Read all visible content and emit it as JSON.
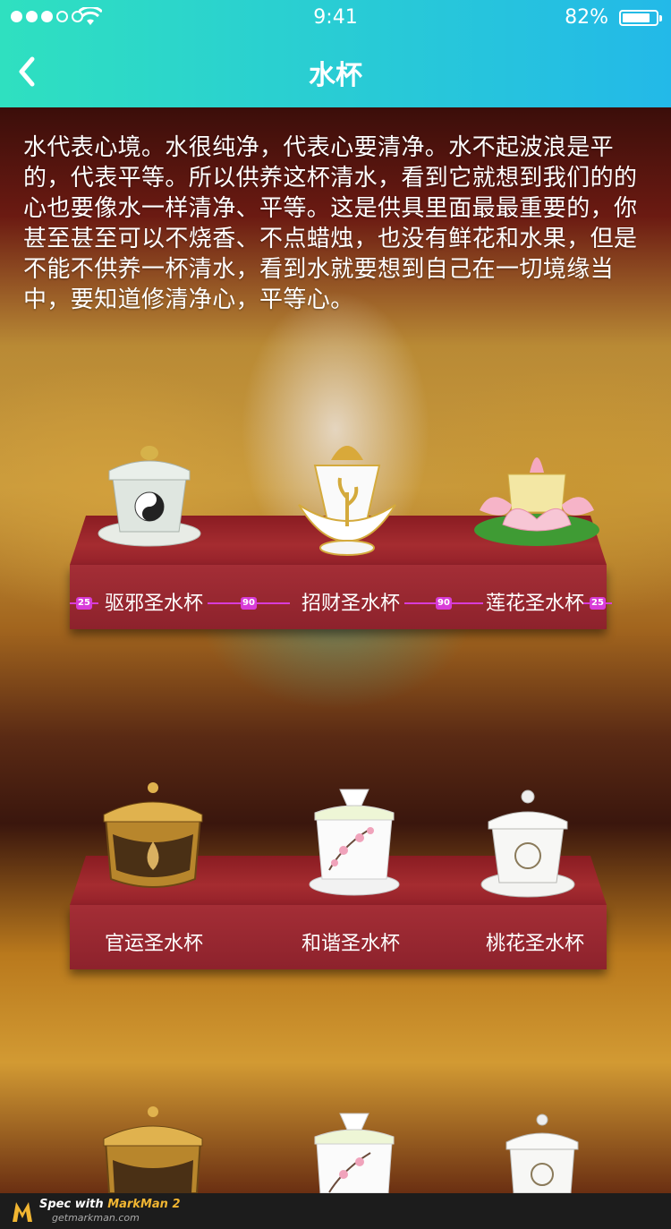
{
  "status_bar": {
    "time": "9:41",
    "battery": "82%",
    "battery_level": 0.82,
    "signal_bars": 3,
    "signal_total": 5
  },
  "nav": {
    "title": "水杯"
  },
  "intro_text": "水代表心境。水很纯净，代表心要清净。水不起波浪是平的，代表平等。所以供养这杯清水，看到它就想到我们的的心也要像水一样清净、平等。这是供具里面最最重要的，你甚至甚至可以不烧香、不点蜡烛，也没有鲜花和水果，但是不能不供养一杯清水，看到水就要想到自己在一切境缘当中，要知道修清净心，平等心。",
  "shelves": [
    {
      "items": [
        {
          "label": "驱邪圣水杯",
          "icon": "taiji-cup-icon"
        },
        {
          "label": "招财圣水杯",
          "icon": "golden-dragon-cup-icon"
        },
        {
          "label": "莲花圣水杯",
          "icon": "lotus-cup-icon"
        }
      ]
    },
    {
      "items": [
        {
          "label": "官运圣水杯",
          "icon": "gold-lotus-jar-icon"
        },
        {
          "label": "和谐圣水杯",
          "icon": "plum-blossom-jar-icon"
        },
        {
          "label": "桃花圣水杯",
          "icon": "guanyin-cup-icon"
        }
      ]
    }
  ],
  "spec_annotations": {
    "margin_left": "25",
    "gap_1": "90",
    "gap_2": "90",
    "margin_right": "25"
  },
  "footer": {
    "spec_label": "Spec with ",
    "brand": "MarkMan 2",
    "url": "getmarkman.com"
  }
}
